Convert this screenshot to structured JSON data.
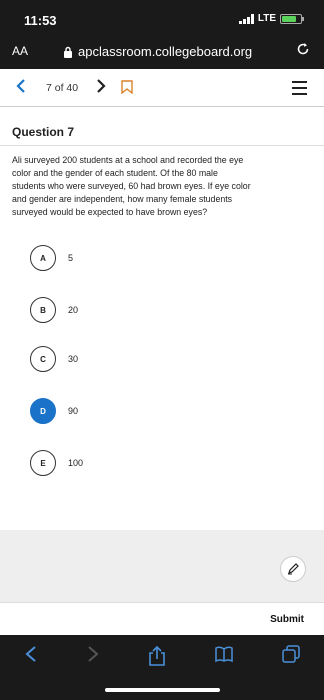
{
  "status": {
    "time": "11:53",
    "network": "LTE",
    "battery_level": 0.8
  },
  "browser": {
    "text_size_label": "AA",
    "url": "apclassroom.collegeboard.org"
  },
  "nav": {
    "progress": "7 of 40"
  },
  "question": {
    "title": "Question 7",
    "prompt_lines": [
      "Ali surveyed 200 students at a school and recorded the eye",
      "color and the gender of each student. Of the 80 male",
      "students who were surveyed, 60 had brown eyes. If eye color",
      "and gender are independent, how many female students",
      "surveyed would be expected to have brown eyes?"
    ],
    "choices": [
      {
        "letter": "A",
        "text": "5",
        "selected": false
      },
      {
        "letter": "B",
        "text": "20",
        "selected": false
      },
      {
        "letter": "C",
        "text": "30",
        "selected": false
      },
      {
        "letter": "D",
        "text": "90",
        "selected": true
      },
      {
        "letter": "E",
        "text": "100",
        "selected": false
      }
    ]
  },
  "actions": {
    "submit_label": "Submit"
  },
  "colors": {
    "accent": "#1a73c8",
    "bars": "#1a1a1a",
    "gray_area": "#eeeeee"
  },
  "icons": {
    "nav_prev": "chevron-left-icon",
    "nav_next": "chevron-right-icon",
    "bookmark": "bookmark-icon",
    "menu": "hamburger-menu-icon",
    "annotate": "pencil-icon",
    "toolbar": [
      "back-icon",
      "forward-icon",
      "share-icon",
      "bookmarks-icon",
      "tabs-icon"
    ]
  }
}
